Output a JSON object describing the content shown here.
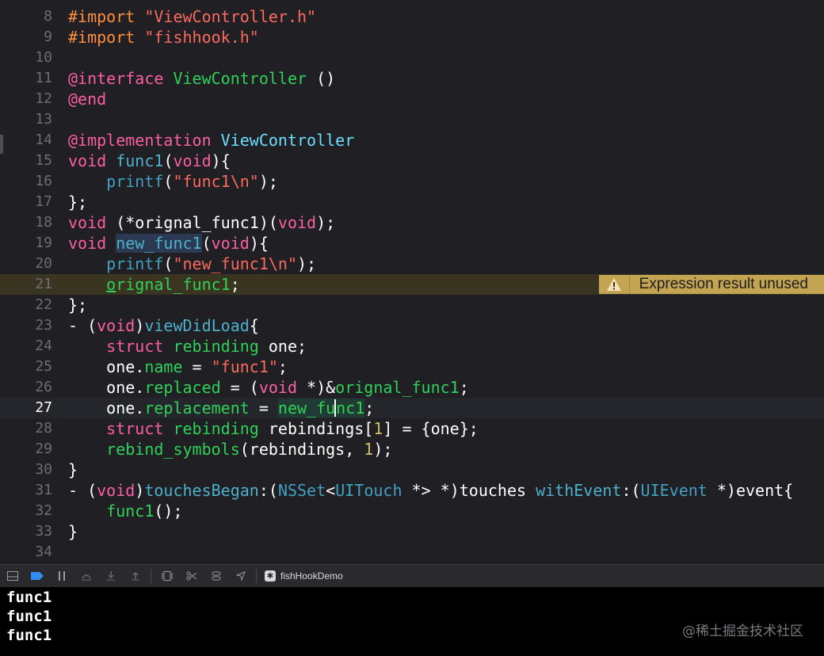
{
  "editor": {
    "lines": [
      {
        "n": "8"
      },
      {
        "n": "9"
      },
      {
        "n": "10"
      },
      {
        "n": "11"
      },
      {
        "n": "12"
      },
      {
        "n": "13"
      },
      {
        "n": "14"
      },
      {
        "n": "15"
      },
      {
        "n": "16"
      },
      {
        "n": "17"
      },
      {
        "n": "18"
      },
      {
        "n": "19"
      },
      {
        "n": "20"
      },
      {
        "n": "21"
      },
      {
        "n": "22"
      },
      {
        "n": "23"
      },
      {
        "n": "24"
      },
      {
        "n": "25"
      },
      {
        "n": "26"
      },
      {
        "n": "27"
      },
      {
        "n": "28"
      },
      {
        "n": "29"
      },
      {
        "n": "30"
      },
      {
        "n": "31"
      },
      {
        "n": "32"
      },
      {
        "n": "33"
      },
      {
        "n": "34"
      }
    ],
    "warning": "Expression result unused"
  },
  "debug_bar": {
    "target": "fishHookDemo"
  },
  "console": {
    "output": [
      "func1",
      "func1",
      "func1"
    ]
  },
  "watermark": "@稀土掘金技术社区",
  "colors": {
    "background": "#1f1f24",
    "warning_badge": "#c3a453",
    "string": "#fc6a5d",
    "keyword": "#fc5fa3"
  }
}
